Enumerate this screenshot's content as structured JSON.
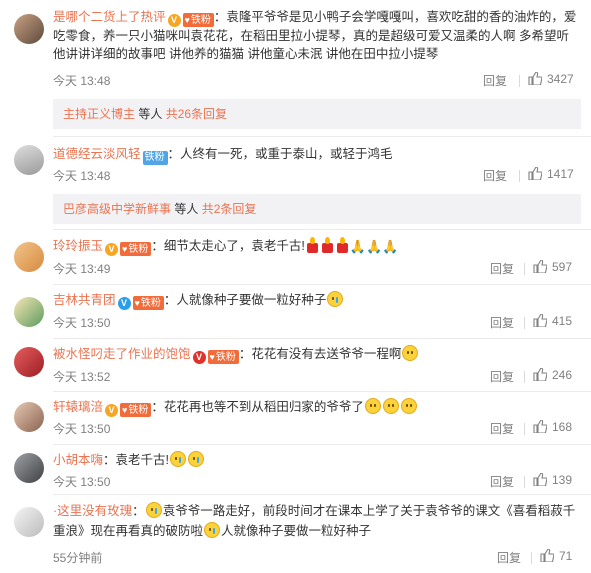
{
  "comments": [
    {
      "name": "是哪个二货上了热评",
      "v_badge": "gold",
      "fan_label": "铁粉",
      "text": "：袁隆平爷爷是见小鸭子会学嘎嘎叫，喜欢吃甜的香的油炸的，爱吃零食，养一只小猫咪叫袁花花，在稻田里拉小提琴，真的是超级可爱又温柔的人啊 多希望听他讲讲详细的故事吧 讲他养的猫猫 讲他童心未泯 讲他在田中拉小提琴",
      "time": "今天 13:48",
      "reply": "回复",
      "likes": "3427",
      "sub": {
        "name": "主持正义博主",
        "mid": " 等人 ",
        "link": "共26条回复"
      }
    },
    {
      "name": "道德经云淡风轻",
      "fan_label": "铁粉",
      "text": "：人终有一死，或重于泰山，或轻于鸿毛",
      "time": "今天 13:48",
      "reply": "回复",
      "likes": "1417",
      "sub": {
        "name": "巴彦高级中学新鲜事",
        "mid": " 等人 ",
        "link": "共2条回复"
      }
    },
    {
      "name": "玲玲振玉",
      "v_badge": "gold",
      "fan_label": "铁粉",
      "text": "：细节太走心了，袁老千古!",
      "time": "今天 13:49",
      "reply": "回复",
      "likes": "597"
    },
    {
      "name": "吉林共青团",
      "v_badge": "blue",
      "fan_label": "铁粉",
      "text": "：人就像种子要做一粒好种子",
      "time": "今天 13:50",
      "reply": "回复",
      "likes": "415"
    },
    {
      "name": "被水怪叼走了作业的饱饱",
      "v_badge": "red",
      "fan_label": "铁粉",
      "text": "：花花有没有去送爷爷一程啊",
      "time": "今天 13:52",
      "reply": "回复",
      "likes": "246"
    },
    {
      "name": "轩辕璃涪",
      "v_badge": "gold",
      "fan_label": "铁粉",
      "text": "：花花再也等不到从稻田归家的爷爷了",
      "time": "今天 13:50",
      "reply": "回复",
      "likes": "168"
    },
    {
      "name": "小胡本嗨",
      "text": "：袁老千古!",
      "time": "今天 13:50",
      "reply": "回复",
      "likes": "139"
    },
    {
      "name": "·这里没有玫瑰",
      "text_a": "：",
      "text_b": "袁爷爷一路走好，前段时间才在课本上学了关于袁爷爷的课文《喜看稻菽千重浪》现在再看真的破防啦",
      "text_c": "人就像种子要做一粒好种子",
      "time": "55分钟前",
      "reply": "回复",
      "likes": "71"
    }
  ],
  "icons": {
    "thumb": "thumbs-up-icon",
    "vip_badge": "v-badge-icon",
    "fan_heart": "heart-icon",
    "emoji_cry": "crying-face-emoji",
    "emoji_sad": "sad-face-emoji",
    "candle": "candle-emoji",
    "pray": "praying-hands-emoji"
  },
  "colors": {
    "name": "#eb7350",
    "meta": "#808080",
    "fan_badge": "#f26b3a",
    "sub_bg": "#f2f2f5"
  }
}
